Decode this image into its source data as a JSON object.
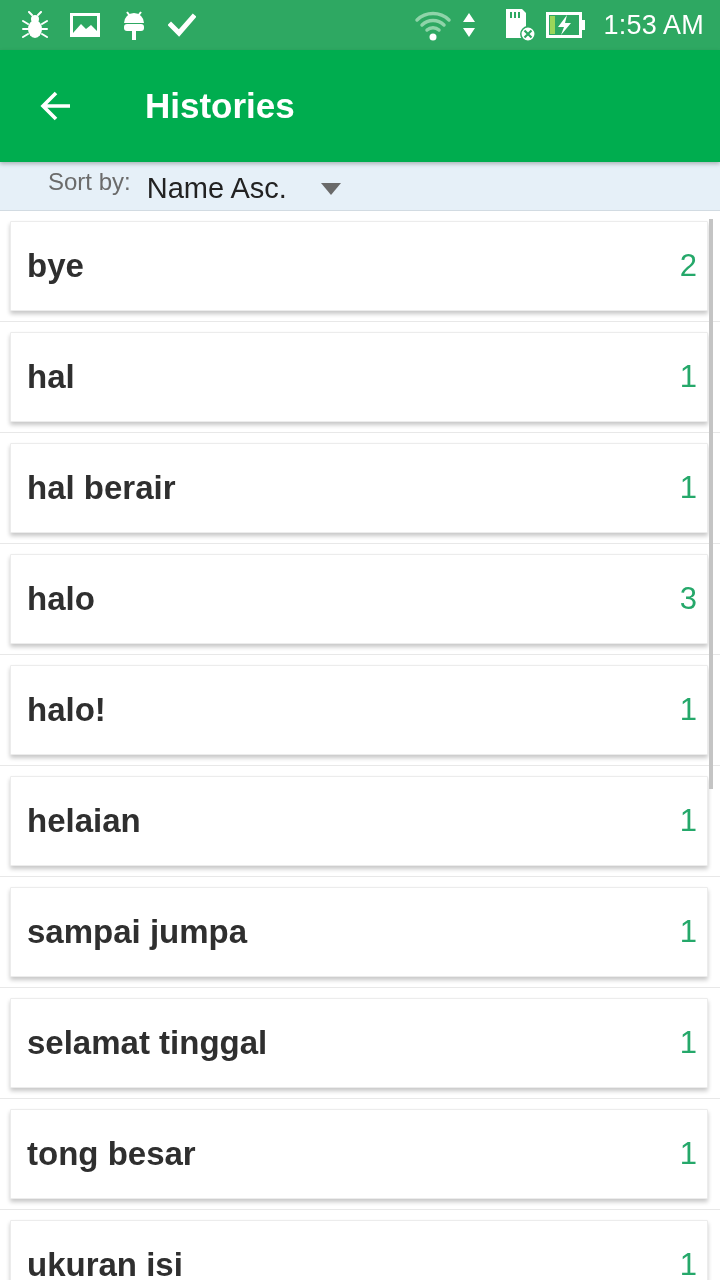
{
  "status_bar": {
    "time": "1:53 AM"
  },
  "app_bar": {
    "title": "Histories"
  },
  "sort": {
    "label": "Sort by:",
    "value": "Name Asc."
  },
  "histories": [
    {
      "name": "bye",
      "count": "2"
    },
    {
      "name": "hal",
      "count": "1"
    },
    {
      "name": "hal berair",
      "count": "1"
    },
    {
      "name": "halo",
      "count": "3"
    },
    {
      "name": "halo!",
      "count": "1"
    },
    {
      "name": "helaian",
      "count": "1"
    },
    {
      "name": "sampai jumpa",
      "count": "1"
    },
    {
      "name": "selamat tinggal",
      "count": "1"
    },
    {
      "name": "tong besar",
      "count": "1"
    },
    {
      "name": "ukuran isi",
      "count": "1"
    }
  ]
}
